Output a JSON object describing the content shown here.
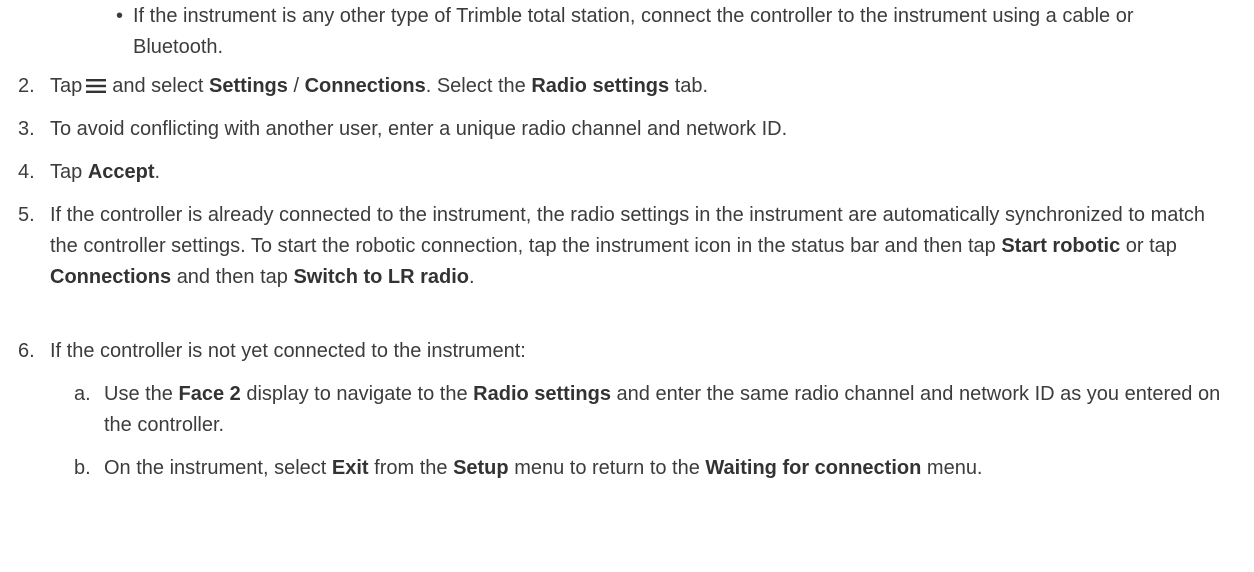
{
  "bullet": {
    "marker": "•",
    "text": "If the instrument is any other type of Trimble total station, connect the controller to the instrument using a cable or Bluetooth."
  },
  "steps": [
    {
      "number": "2.",
      "parts": [
        "Tap",
        "and select",
        "Settings",
        "/",
        "Connections",
        ". Select the",
        "Radio settings",
        "tab."
      ]
    },
    {
      "number": "3.",
      "text": "To avoid conflicting with another user, enter a unique radio channel and network ID."
    },
    {
      "number": "4.",
      "parts": [
        "Tap",
        "Accept",
        "."
      ]
    },
    {
      "number": "5.",
      "parts": [
        "If the controller is already connected to the instrument, the radio settings in the instrument are automatically synchronized to match the controller settings. To start the robotic connection, tap the instrument icon in the status bar and then tap",
        "Start robotic",
        "or tap",
        "Connections",
        "and then tap",
        "Switch to LR radio",
        "."
      ]
    },
    {
      "number": "6.",
      "text": "If the controller is not yet connected to the instrument:",
      "substeps": [
        {
          "letter": "a.",
          "parts": [
            "Use the",
            "Face 2",
            "display to navigate to the",
            "Radio settings",
            "and enter the same radio channel and network ID as you entered on the controller."
          ]
        },
        {
          "letter": "b.",
          "parts": [
            "On the instrument, select",
            "Exit",
            "from the",
            "Setup",
            "menu to return to the",
            "Waiting for connection",
            "menu."
          ]
        }
      ]
    }
  ],
  "icons": {
    "menu": "menu-icon"
  }
}
